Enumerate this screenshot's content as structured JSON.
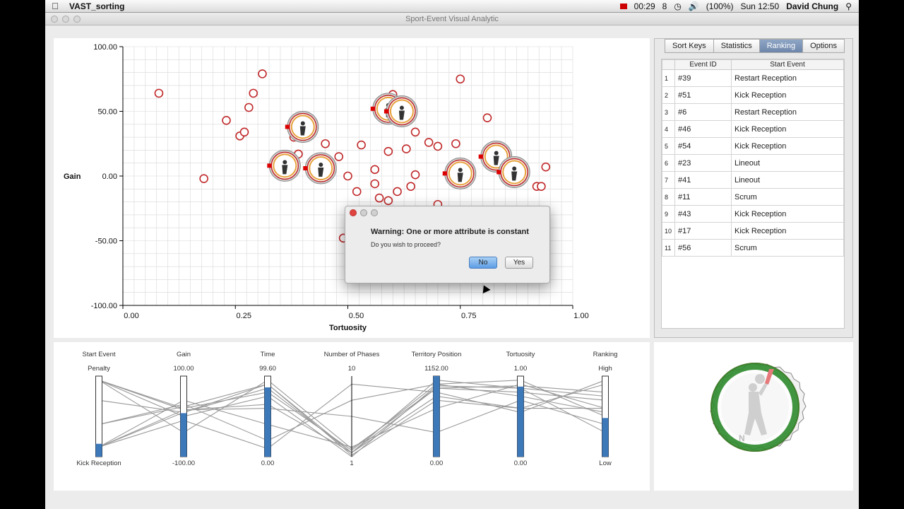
{
  "menubar": {
    "app_name": "VAST_sorting",
    "clock_time": "00:29",
    "notification_count": "8",
    "battery": "(100%)",
    "datetime": "Sun 12:50",
    "user": "David Chung"
  },
  "window": {
    "title": "Sport-Event Visual Analytic"
  },
  "tabs": [
    {
      "label": "Sort Keys",
      "active": false
    },
    {
      "label": "Statistics",
      "active": false
    },
    {
      "label": "Ranking",
      "active": true
    },
    {
      "label": "Options",
      "active": false
    }
  ],
  "ranking_table": {
    "columns": [
      "Event ID",
      "Start Event"
    ],
    "rows": [
      {
        "rank": "1",
        "event_id": "#39",
        "start_event": "Restart Reception"
      },
      {
        "rank": "2",
        "event_id": "#51",
        "start_event": "Kick Reception"
      },
      {
        "rank": "3",
        "event_id": "#6",
        "start_event": "Restart Reception"
      },
      {
        "rank": "4",
        "event_id": "#46",
        "start_event": "Kick Reception"
      },
      {
        "rank": "5",
        "event_id": "#54",
        "start_event": "Kick Reception"
      },
      {
        "rank": "6",
        "event_id": "#23",
        "start_event": "Lineout"
      },
      {
        "rank": "7",
        "event_id": "#41",
        "start_event": "Lineout"
      },
      {
        "rank": "8",
        "event_id": "#11",
        "start_event": "Scrum"
      },
      {
        "rank": "9",
        "event_id": "#43",
        "start_event": "Kick Reception"
      },
      {
        "rank": "10",
        "event_id": "#17",
        "start_event": "Kick Reception"
      },
      {
        "rank": "11",
        "event_id": "#56",
        "start_event": "Scrum"
      }
    ]
  },
  "dialog": {
    "message": "Warning: One or more attribute is constant",
    "question": "Do you wish to proceed?",
    "no_label": "No",
    "yes_label": "Yes"
  },
  "colors": {
    "point": "#c0282a",
    "axis_bar": "#3d78b9",
    "grid": "#d8d8d8",
    "glyph_ring": "#2e8b2e"
  },
  "chart_data": {
    "type": "scatter",
    "xlabel": "Tortuosity",
    "ylabel": "Gain",
    "xlim": [
      0,
      1
    ],
    "ylim": [
      -100,
      100
    ],
    "x_ticks": [
      "0.00",
      "0.25",
      "0.50",
      "0.75",
      "1.00"
    ],
    "y_ticks": [
      "100.00",
      "50.00",
      "0.00",
      "-50.00",
      "-100.00"
    ],
    "grid": true,
    "points": [
      {
        "x": 0.08,
        "y": 64
      },
      {
        "x": 0.18,
        "y": -2
      },
      {
        "x": 0.23,
        "y": 43
      },
      {
        "x": 0.26,
        "y": 31
      },
      {
        "x": 0.27,
        "y": 34
      },
      {
        "x": 0.28,
        "y": 53
      },
      {
        "x": 0.29,
        "y": 64
      },
      {
        "x": 0.31,
        "y": 79
      },
      {
        "x": 0.38,
        "y": 30
      },
      {
        "x": 0.39,
        "y": 17
      },
      {
        "x": 0.45,
        "y": 25
      },
      {
        "x": 0.48,
        "y": 15
      },
      {
        "x": 0.5,
        "y": 0
      },
      {
        "x": 0.52,
        "y": -12
      },
      {
        "x": 0.53,
        "y": 24
      },
      {
        "x": 0.56,
        "y": 5
      },
      {
        "x": 0.56,
        "y": -6
      },
      {
        "x": 0.57,
        "y": -17
      },
      {
        "x": 0.59,
        "y": -19
      },
      {
        "x": 0.59,
        "y": 19
      },
      {
        "x": 0.6,
        "y": 63
      },
      {
        "x": 0.61,
        "y": -12
      },
      {
        "x": 0.63,
        "y": 21
      },
      {
        "x": 0.64,
        "y": -8
      },
      {
        "x": 0.65,
        "y": 1
      },
      {
        "x": 0.65,
        "y": 34
      },
      {
        "x": 0.68,
        "y": 26
      },
      {
        "x": 0.7,
        "y": 23
      },
      {
        "x": 0.7,
        "y": -22
      },
      {
        "x": 0.74,
        "y": 25
      },
      {
        "x": 0.75,
        "y": 75
      },
      {
        "x": 0.81,
        "y": 45
      },
      {
        "x": 0.92,
        "y": -8
      },
      {
        "x": 0.93,
        "y": -8
      },
      {
        "x": 0.94,
        "y": 7
      },
      {
        "x": 0.49,
        "y": -48
      }
    ],
    "glyphs": [
      {
        "x": 0.4,
        "y": 38
      },
      {
        "x": 0.36,
        "y": 8
      },
      {
        "x": 0.44,
        "y": 6
      },
      {
        "x": 0.59,
        "y": 52
      },
      {
        "x": 0.62,
        "y": 50
      },
      {
        "x": 0.75,
        "y": 2
      },
      {
        "x": 0.83,
        "y": 15
      },
      {
        "x": 0.87,
        "y": 3
      }
    ]
  },
  "parallel_coords": {
    "axes": [
      {
        "name": "Start Event",
        "top": "Penalty",
        "bottom": "Kick Reception",
        "fill": 0.16
      },
      {
        "name": "Gain",
        "top": "100.00",
        "bottom": "-100.00",
        "fill": 0.54
      },
      {
        "name": "Time",
        "top": "99.60",
        "bottom": "0.00",
        "fill": 0.86
      },
      {
        "name": "Number of Phases",
        "top": "10",
        "bottom": "1",
        "fill": 0
      },
      {
        "name": "Territory Position",
        "top": "1152.00",
        "bottom": "0.00",
        "fill": 1.0
      },
      {
        "name": "Tortuosity",
        "top": "1.00",
        "bottom": "0.00",
        "fill": 0.87
      },
      {
        "name": "Ranking",
        "top": "High",
        "bottom": "Low",
        "fill": 0.48
      }
    ],
    "lines": [
      [
        0.12,
        0.55,
        0.9,
        0.05,
        0.95,
        0.85,
        0.3
      ],
      [
        0.95,
        0.6,
        0.8,
        0.08,
        0.9,
        0.75,
        0.55
      ],
      [
        0.95,
        0.3,
        0.95,
        0.1,
        0.85,
        0.8,
        0.7
      ],
      [
        0.12,
        0.7,
        0.4,
        0.12,
        0.6,
        0.9,
        0.6
      ],
      [
        0.7,
        0.55,
        0.85,
        0.05,
        0.75,
        0.6,
        0.9
      ],
      [
        0.4,
        0.65,
        0.2,
        0.7,
        0.9,
        0.95,
        0.5
      ],
      [
        0.12,
        0.58,
        0.6,
        0.5,
        0.3,
        0.7,
        0.4
      ],
      [
        0.95,
        0.5,
        0.75,
        0.0,
        0.88,
        0.85,
        0.75
      ],
      [
        0.12,
        0.45,
        0.1,
        0.9,
        0.8,
        0.55,
        0.95
      ],
      [
        0.4,
        0.62,
        0.9,
        0.02,
        0.7,
        0.6,
        0.6
      ],
      [
        0.95,
        0.58,
        0.65,
        0.05,
        0.85,
        0.88,
        0.8
      ]
    ]
  }
}
